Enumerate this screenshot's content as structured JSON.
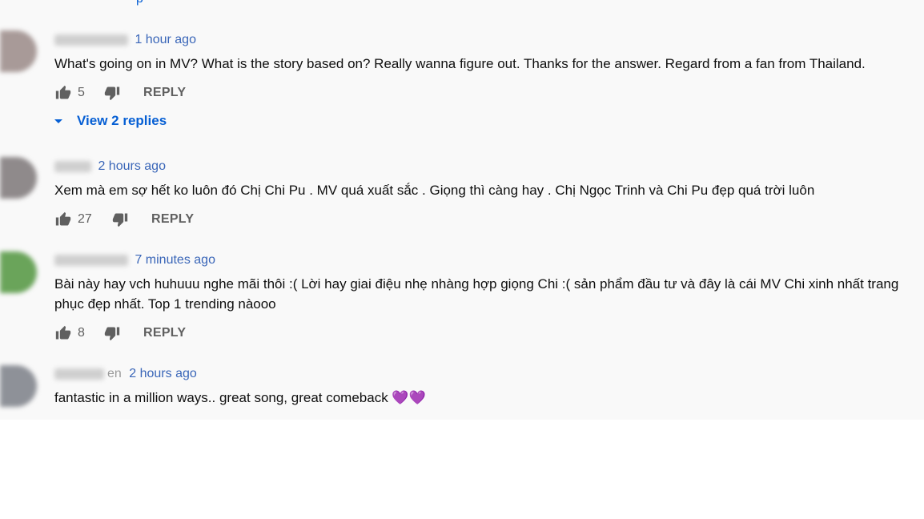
{
  "top_fragment": "p",
  "comments": [
    {
      "avatar_color": "#a89a98",
      "time": "1 hour ago",
      "text": "What's going on in MV? What is the story based on? Really wanna figure out. Thanks for the answer.  Regard from a fan from Thailand.",
      "likes": "5",
      "reply_label": "REPLY",
      "view_replies": "View 2 replies"
    },
    {
      "avatar_color": "#8f8a8b",
      "time": "2 hours ago",
      "text": "Xem mà em sợ hết ko luôn đó Chị Chi Pu . MV quá xuất sắc . Giọng thì càng hay . Chị Ngọc Trinh và Chi Pu đẹp quá trời luôn",
      "likes": "27",
      "reply_label": "REPLY"
    },
    {
      "avatar_color": "#6aa45a",
      "time": "7 minutes ago",
      "text": "Bài này hay vch huhuuu nghe mãi thôi :( Lời hay giai điệu nhẹ nhàng hợp giọng Chi :( sản phẩm đầu tư và đây là cái MV Chi xinh nhất trang phục đẹp nhất. Top 1 trending nàooo",
      "likes": "8",
      "reply_label": "REPLY"
    },
    {
      "avatar_color": "#8e9198",
      "name_fragment": "en",
      "time": "2 hours ago",
      "text": "fantastic in a million ways.. great song, great comeback 💜💜"
    }
  ]
}
